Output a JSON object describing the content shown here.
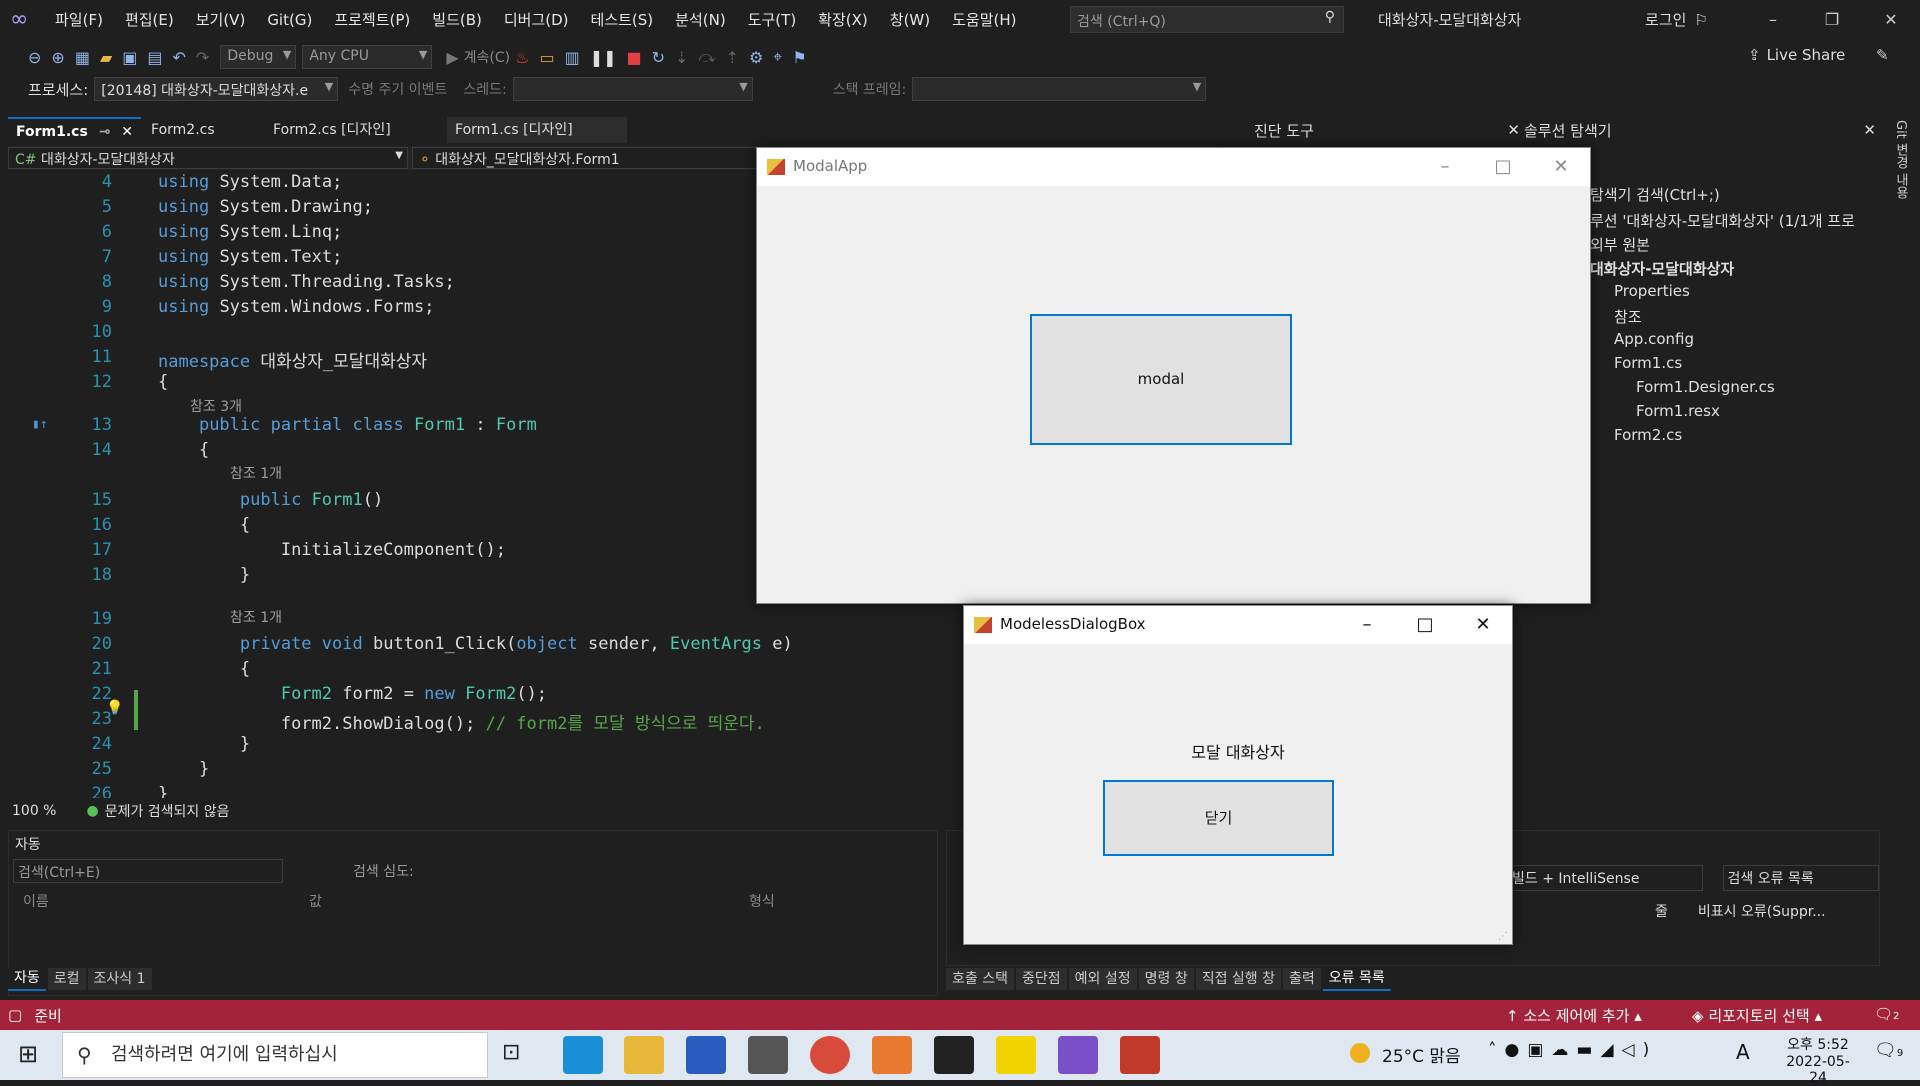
{
  "vs": {
    "menu": [
      "파일(F)",
      "편집(E)",
      "보기(V)",
      "Git(G)",
      "프로젝트(P)",
      "빌드(B)",
      "디버그(D)",
      "테스트(S)",
      "분석(N)",
      "도구(T)",
      "확장(X)",
      "창(W)",
      "도움말(H)"
    ],
    "search_placeholder": "검색 (Ctrl+Q)",
    "window_title": "대화상자-모달대화상자",
    "login": "로그인",
    "live_share": "Live Share",
    "config": "Debug",
    "platform": "Any CPU",
    "continue_label": "계속(C)",
    "process_label": "프로세스:",
    "process_value": "[20148] 대화상자-모달대화상자.e",
    "lifecycle_label": "수명 주기 이벤트",
    "thread_label": "스레드:",
    "stackframe_label": "스택 프레임:"
  },
  "tabs": [
    "Form1.cs",
    "Form2.cs",
    "Form2.cs [디자인]",
    "Form1.cs [디자인]"
  ],
  "nav": {
    "project": "대화상자-모달대화상자",
    "class": "대화상자_모달대화상자.Form1"
  },
  "code_lines": [
    {
      "n": "4",
      "t": "using System.Data;"
    },
    {
      "n": "5",
      "t": "using System.Drawing;"
    },
    {
      "n": "6",
      "t": "using System.Linq;"
    },
    {
      "n": "7",
      "t": "using System.Text;"
    },
    {
      "n": "8",
      "t": "using System.Threading.Tasks;"
    },
    {
      "n": "9",
      "t": "using System.Windows.Forms;"
    },
    {
      "n": "10",
      "t": ""
    },
    {
      "n": "11",
      "t": "namespace 대화상자_모달대화상자"
    },
    {
      "n": "12",
      "t": "{"
    },
    {
      "n": "13",
      "t": "    public partial class Form1 : Form"
    },
    {
      "n": "14",
      "t": "    {"
    },
    {
      "n": "15",
      "t": "        public Form1()"
    },
    {
      "n": "16",
      "t": "        {"
    },
    {
      "n": "17",
      "t": "            InitializeComponent();"
    },
    {
      "n": "18",
      "t": "        }"
    },
    {
      "n": "19",
      "t": ""
    },
    {
      "n": "20",
      "t": "        private void button1_Click(object sender, EventArgs e)"
    },
    {
      "n": "21",
      "t": "        {"
    },
    {
      "n": "22",
      "t": "            Form2 form2 = new Form2();"
    },
    {
      "n": "23",
      "t": "            form2.ShowDialog(); // form2를 모달 방식으로 띄운다."
    },
    {
      "n": "24",
      "t": "        }"
    },
    {
      "n": "25",
      "t": "    }"
    },
    {
      "n": "26",
      "t": "}"
    }
  ],
  "refs": {
    "r3": "참조 3개",
    "r1a": "참조 1개",
    "r1b": "참조 1개"
  },
  "editor_status": {
    "zoom": "100 %",
    "issues": "문제가 검색되지 않음"
  },
  "diag_title": "진단 도구",
  "solution": {
    "title": "솔루션 탐색기",
    "search": "탐색기 검색(Ctrl+;)",
    "items": [
      "루션 '대화상자-모달대화상자' (1/1개 프로",
      "외부 원본",
      "대화상자-모달대화상자",
      "Properties",
      "참조",
      "App.config",
      "Form1.cs",
      "Form1.Designer.cs",
      "Form1.resx",
      "Form2.cs"
    ]
  },
  "git_changes": "Git 변경 내용",
  "auto_panel": {
    "title": "자동",
    "search": "검색(Ctrl+E)",
    "depth": "검색 심도:",
    "cols": [
      "이름",
      "값",
      "형식"
    ],
    "tabs": [
      "자동",
      "로컬",
      "조사식 1"
    ]
  },
  "error_panel": {
    "build": "빌드 + IntelliSense",
    "search": "검색 오류 목록",
    "col1": "줄",
    "col2": "비표시 오류(Suppr...",
    "tabs": [
      "호출 스택",
      "중단점",
      "예외 설정",
      "명령 창",
      "직접 실행 창",
      "출력",
      "오류 목록"
    ]
  },
  "status": {
    "ready": "준비",
    "add_source": "소스 제어에 추가",
    "repo": "리포지토리 선택",
    "notif": "2"
  },
  "modal_app": {
    "title": "ModalApp",
    "button": "modal"
  },
  "modeless": {
    "title": "ModelessDialogBox",
    "label": "모달 대화상자",
    "button": "닫기"
  },
  "taskbar": {
    "search": "검색하려면 여기에 입력하십시",
    "temp": "25°C 맑음",
    "time": "오후 5:52",
    "date": "2022-05-24",
    "ime": "A",
    "notif": "9"
  }
}
